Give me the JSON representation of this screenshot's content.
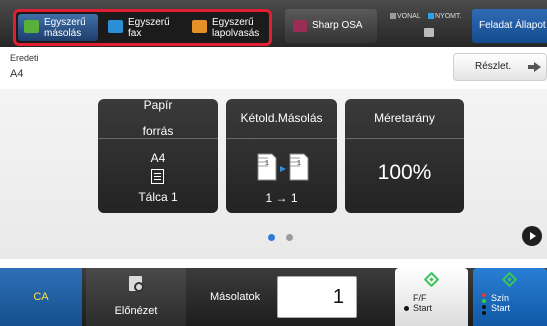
{
  "header": {
    "quick_tabs": [
      {
        "label_line1": "Egyszerű",
        "label_line2": "másolás",
        "icon": "copy-icon",
        "color": "#58b03a",
        "selected": true
      },
      {
        "label_line1": "Egyszerű",
        "label_line2": "fax",
        "icon": "fax-icon",
        "color": "#2a8fd6",
        "selected": false
      },
      {
        "label_line1": "Egyszerű",
        "label_line2": "lapolvasás",
        "icon": "scan-icon",
        "color": "#e5912a",
        "selected": false
      }
    ],
    "highlight_color": "#e01f35",
    "sharp_osa_label": "Sharp OSA",
    "status": {
      "line": "VONAL",
      "print": "NYOMT.",
      "line_color": "#9a9a9a",
      "print_color": "#2aa3e8"
    },
    "job_status_label": "Feladat Állapot"
  },
  "original": {
    "label": "Eredeti",
    "value": "A4"
  },
  "detail_button": {
    "label": "Részlet."
  },
  "cards": {
    "paper": {
      "title_line1": "Papír",
      "title_line2": "forrás",
      "size": "A4",
      "tray": "Tálca 1"
    },
    "duplex": {
      "title": "Kétold.Másolás",
      "page_from": "1",
      "page_to": "1",
      "mode": "1 → 1"
    },
    "ratio": {
      "title": "Méretarány",
      "value": "100%"
    }
  },
  "pager": {
    "pages": 2,
    "current_page": 1
  },
  "footer": {
    "ca_label": "CA",
    "preview_label": "Előnézet",
    "copies_label": "Másolatok",
    "copies_value": "1",
    "bw_start_mode": "F/F",
    "bw_start_label": "Start",
    "color_start_mode": "Szín",
    "color_start_label": "Start",
    "accent_color": "#1f6fc4",
    "start_green": "#3ac45a"
  }
}
